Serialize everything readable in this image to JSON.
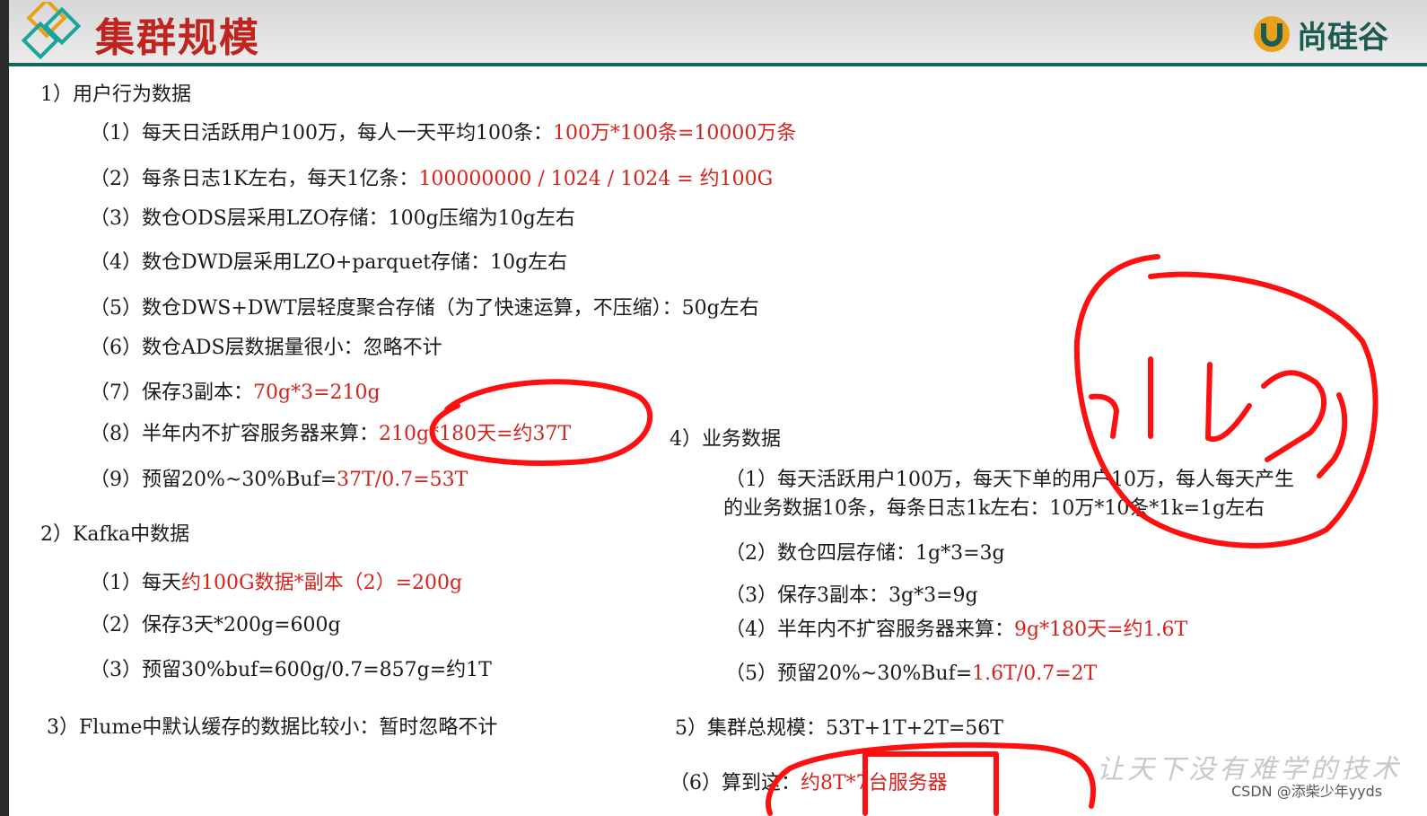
{
  "header": {
    "title": "集群规模",
    "brand_text": "尚硅谷",
    "brand_icon": "u-logo-icon"
  },
  "section1": {
    "heading": "1）用户行为数据",
    "items": [
      {
        "label": "（1）每天日活跃用户100万，每人一天平均100条：",
        "highlight": "100万*100条=10000万条"
      },
      {
        "label": "（2）每条日志1K左右，每天1亿条：",
        "highlight": "100000000 / 1024 / 1024 = 约100G"
      },
      {
        "label": "（3）数仓ODS层采用LZO存储：100g压缩为10g左右",
        "highlight": ""
      },
      {
        "label": "（4）数仓DWD层采用LZO+parquet存储：10g左右",
        "highlight": ""
      },
      {
        "label": "（5）数仓DWS+DWT层轻度聚合存储（为了快速运算，不压缩）：50g左右",
        "highlight": ""
      },
      {
        "label": "（6）数仓ADS层数据量很小：忽略不计",
        "highlight": ""
      },
      {
        "label": "（7）保存3副本：",
        "highlight": "70g*3=210g"
      },
      {
        "label": "（8）半年内不扩容服务器来算：",
        "highlight": "210g*180天=约37T"
      },
      {
        "label": "（9）预留20%~30%Buf=",
        "highlight": "37T/0.7=53T"
      }
    ]
  },
  "section2": {
    "heading": "2）Kafka中数据",
    "items": [
      {
        "label": "（1）每天",
        "highlight": "约100G数据*副本（2）=200g"
      },
      {
        "label": "（2）保存3天*200g=600g",
        "highlight": ""
      },
      {
        "label": "（3）预留30%buf=600g/0.7=857g=约1T",
        "highlight": ""
      }
    ]
  },
  "section3": {
    "heading": "3）Flume中默认缓存的数据比较小：暂时忽略不计"
  },
  "section4": {
    "heading": "4）业务数据",
    "items": [
      {
        "label": "（1）每天活跃用户100万，每天下单的用户10万，每人每天产生",
        "highlight": ""
      },
      {
        "label": "的业务数据10条，每条日志1k左右：10万*10条*1k=1g左右",
        "highlight": ""
      },
      {
        "label": "（2）数仓四层存储：1g*3=3g",
        "highlight": ""
      },
      {
        "label": "（3）保存3副本：3g*3=9g",
        "highlight": ""
      },
      {
        "label": "（4）半年内不扩容服务器来算：",
        "highlight": "9g*180天=约1.6T"
      },
      {
        "label": "（5）预留20%~30%Buf=",
        "highlight": "1.6T/0.7=2T"
      }
    ]
  },
  "section5": {
    "heading": "5）集群总规模：53T+1T+2T=56T"
  },
  "section6": {
    "label": "（6）算到这：",
    "highlight": "约8T*7台服务器"
  },
  "watermark": "让天下没有难学的技术",
  "credit": "CSDN @添柴少年yyds",
  "colors": {
    "title_red": "#c0241e",
    "highlight_red": "#d4231c",
    "header_line": "#14675f",
    "annotation_red": "#ff1010"
  }
}
